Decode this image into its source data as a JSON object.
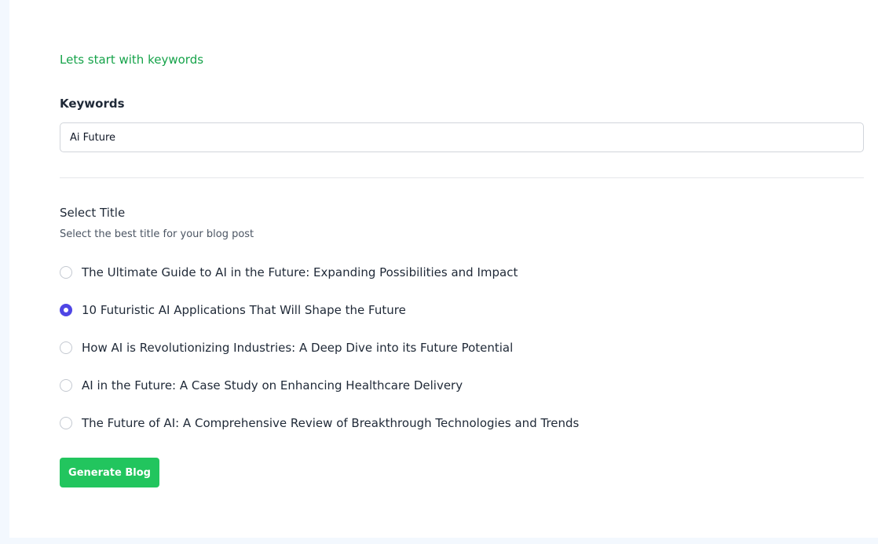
{
  "intro": {
    "text": "Lets start with keywords"
  },
  "keywords": {
    "label": "Keywords",
    "value": "Ai Future"
  },
  "title_select": {
    "heading": "Select Title",
    "subheading": "Select the best title for your blog post",
    "selected_index": 1,
    "options": [
      {
        "label": "The Ultimate Guide to AI in the Future: Expanding Possibilities and Impact"
      },
      {
        "label": "10 Futuristic AI Applications That Will Shape the Future"
      },
      {
        "label": "How AI is Revolutionizing Industries: A Deep Dive into its Future Potential"
      },
      {
        "label": "AI in the Future: A Case Study on Enhancing Healthcare Delivery"
      },
      {
        "label": "The Future of AI: A Comprehensive Review of Breakthrough Technologies and Trends"
      }
    ]
  },
  "actions": {
    "generate_label": "Generate Blog"
  },
  "colors": {
    "accent_green": "#22c55e",
    "intro_green": "#16a34a",
    "radio_selected": "#4f46e5",
    "page_background": "#f3f8fe"
  }
}
